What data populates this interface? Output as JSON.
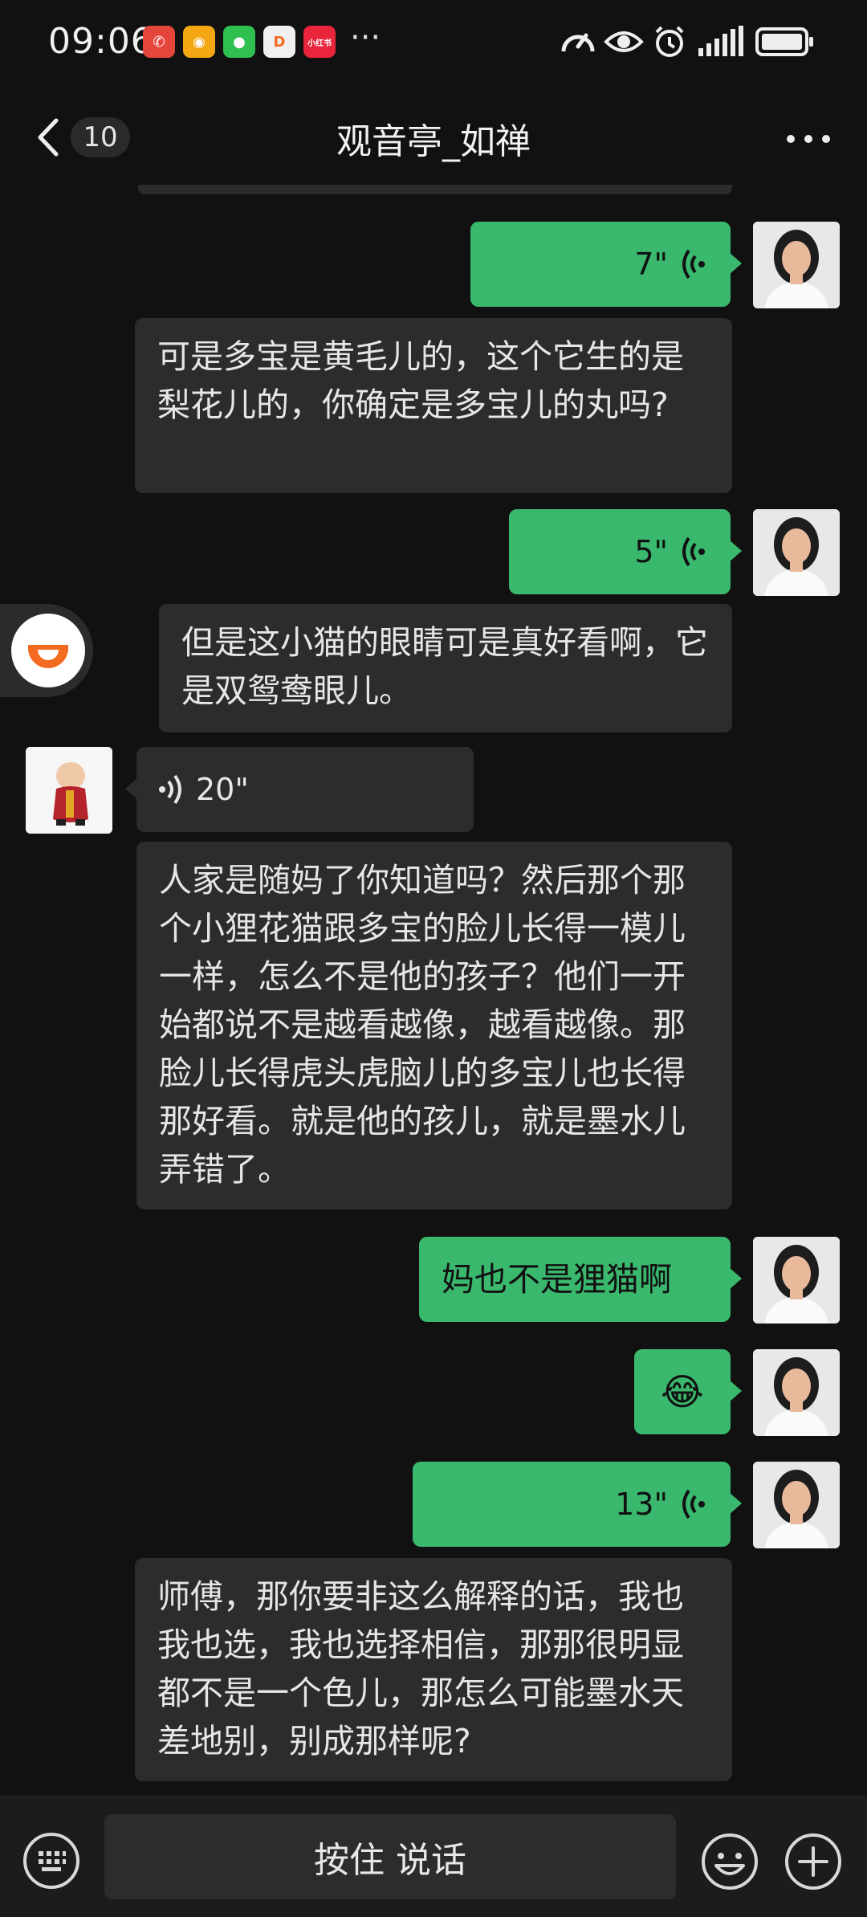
{
  "status_bar": {
    "time": "09:06",
    "more": "···"
  },
  "header": {
    "back_count": "10",
    "title": "观音亭_如禅"
  },
  "messages": {
    "m1": {
      "duration": "7\""
    },
    "m2": {
      "text": "可是多宝是黄毛儿的，这个它生的是梨花儿的，你确定是多宝儿的丸吗?"
    },
    "m3": {
      "duration": "5\""
    },
    "m4": {
      "text": "但是这小猫的眼睛可是真好看啊，它是双鸳鸯眼儿。"
    },
    "m5": {
      "duration": "20\""
    },
    "m6": {
      "text": "人家是随妈了你知道吗？然后那个那个小狸花猫跟多宝的脸儿长得一模儿一样，怎么不是他的孩子？他们一开始都说不是越看越像，越看越像。那脸儿长得虎头虎脑儿的多宝儿也长得那好看。就是他的孩儿，就是墨水儿弄错了。"
    },
    "m7": {
      "text": "妈也不是狸猫啊"
    },
    "m8": {
      "emoji": "😂"
    },
    "m9": {
      "duration": "13\""
    },
    "m10": {
      "text": "师傅，那你要非这么解释的话，我也我也选，我也选择相信，那那很明显都不是一个色儿，那怎么可能墨水天差地别，别成那样呢?"
    }
  },
  "input_bar": {
    "hold_to_talk": "按住 说话"
  },
  "colors": {
    "background": "#111111",
    "outgoing_bubble": "#3ab86e",
    "incoming_bubble": "#2c2c2c"
  }
}
